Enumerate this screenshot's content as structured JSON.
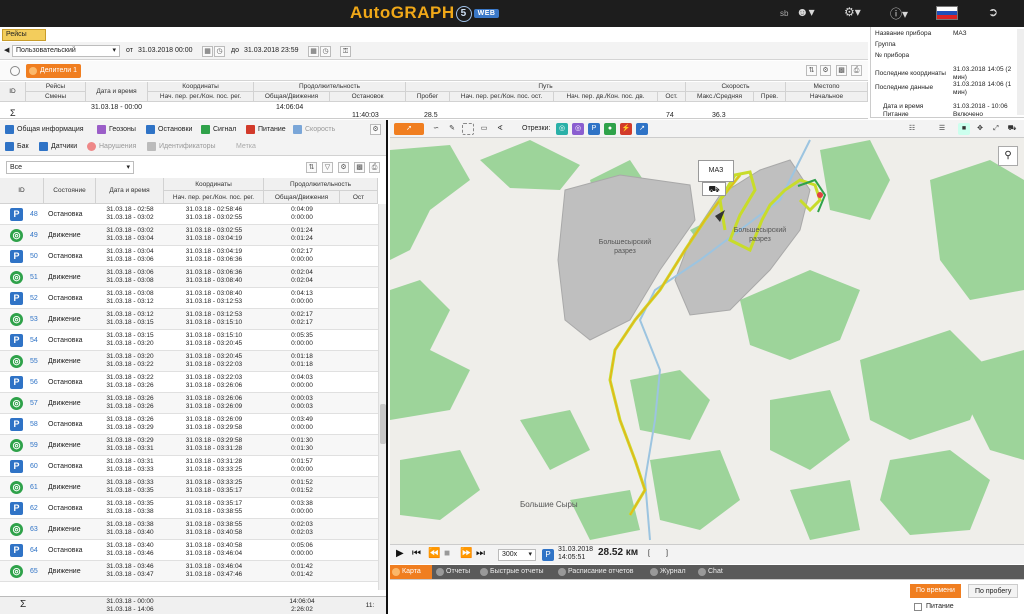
{
  "app": {
    "logo": "AutoGRAPH",
    "logo_num": "5",
    "logo_web": "WEB",
    "user": "sb"
  },
  "colors": {
    "accent": "#f07e20",
    "park": "#2f73c6",
    "move": "#2fa24a",
    "forest": "#9dd49a",
    "quarry": "#bfbfbf",
    "track": "#c8dc2a"
  },
  "panel_tab": "Рейсы",
  "trip_toolbar": {
    "mode": "Пользовательский",
    "from_label": "от",
    "from_value": "31.03.2018 00:00",
    "to_label": "до",
    "to_value": "31.03.2018 23:59"
  },
  "deliteli": "Делители 1",
  "trip_table": {
    "headers": [
      "ID",
      "Рейсы",
      "Дата и время",
      "Координаты",
      "Продолжительность",
      "Путь",
      "Скорость",
      "Местопо"
    ],
    "subheaders": [
      "Смены",
      "Нач. пер. рег./Кон. пос. рег.",
      "Общая/Движения",
      "Остановок",
      "Пробег",
      "Нач. пер. рег./Кон. пос. ост.",
      "Нач. пер. дв./Кон. пос. дв.",
      "Ост.",
      "Макс./Средняя",
      "Прев.",
      "Начальное"
    ],
    "sum_time": "14:06:04",
    "sum_sigma": "Σ",
    "row_date": "31.03.18 - 00:00",
    "row_stop": "11:40:03",
    "row_path": "28.5",
    "row_ost": "74",
    "row_speed": "36.3"
  },
  "info": {
    "rows": [
      {
        "k": "Название прибора",
        "v": "МАЗ"
      },
      {
        "k": "Группа",
        "v": ""
      },
      {
        "k": "№ прибора",
        "v": ""
      },
      {
        "k": "Последние координаты",
        "v": "31.03.2018 14:05 (2 мин)"
      },
      {
        "k": "Последние данные",
        "v": "31.03.2018 14:06 (1 мин)"
      },
      {
        "k": "Дата и время",
        "v": "31.03.2018 - 10:06"
      },
      {
        "k": "Питание",
        "v": "Включено"
      }
    ]
  },
  "left_tabs": [
    {
      "label": "Общая информация",
      "color": "#2f73c6"
    },
    {
      "label": "Геозоны",
      "color": "#9b5ec8"
    },
    {
      "label": "Остановки",
      "color": "#2f73c6"
    },
    {
      "label": "Сигнал",
      "color": "#2fa24a"
    },
    {
      "label": "Питание",
      "color": "#d23a2a"
    },
    {
      "label": "Скорость",
      "color": "#7aa6d8"
    },
    {
      "label": "Бак",
      "color": "#2f73c6"
    },
    {
      "label": "Датчики",
      "color": "#2f73c6"
    },
    {
      "label": "Нарушения",
      "color": "#e04040"
    },
    {
      "label": "Идентификаторы",
      "color": "#aaaaaa"
    },
    {
      "label": "Метка",
      "color": "#cccccc"
    }
  ],
  "filter": {
    "value": "Все"
  },
  "stops_table": {
    "headers": {
      "id": "ID",
      "state": "Состояние",
      "datetime": "Дата и время",
      "coords": "Координаты",
      "coords_sub": "Нач. пер. рег./Кон. пос. рег.",
      "duration": "Продолжительность",
      "duration_sub": "Общая/Движения",
      "last": "Ост"
    },
    "rows": [
      {
        "id": "48",
        "state": "Остановка",
        "type": "p",
        "dt1": "31.03.18 - 02:58",
        "dt2": "31.03.18 - 03:02",
        "c1": "31.03.18 - 02:58:46",
        "c2": "31.03.18 - 03:02:55",
        "d1": "0:04:09",
        "d2": "0:00:00"
      },
      {
        "id": "49",
        "state": "Движение",
        "type": "m",
        "dt1": "31.03.18 - 03:02",
        "dt2": "31.03.18 - 03:04",
        "c1": "31.03.18 - 03:02:55",
        "c2": "31.03.18 - 03:04:19",
        "d1": "0:01:24",
        "d2": "0:01:24"
      },
      {
        "id": "50",
        "state": "Остановка",
        "type": "p",
        "dt1": "31.03.18 - 03:04",
        "dt2": "31.03.18 - 03:06",
        "c1": "31.03.18 - 03:04:19",
        "c2": "31.03.18 - 03:06:36",
        "d1": "0:02:17",
        "d2": "0:00:00"
      },
      {
        "id": "51",
        "state": "Движение",
        "type": "m",
        "dt1": "31.03.18 - 03:06",
        "dt2": "31.03.18 - 03:08",
        "c1": "31.03.18 - 03:06:36",
        "c2": "31.03.18 - 03:08:40",
        "d1": "0:02:04",
        "d2": "0:02:04"
      },
      {
        "id": "52",
        "state": "Остановка",
        "type": "p",
        "dt1": "31.03.18 - 03:08",
        "dt2": "31.03.18 - 03:12",
        "c1": "31.03.18 - 03:08:40",
        "c2": "31.03.18 - 03:12:53",
        "d1": "0:04:13",
        "d2": "0:00:00"
      },
      {
        "id": "53",
        "state": "Движение",
        "type": "m",
        "dt1": "31.03.18 - 03:12",
        "dt2": "31.03.18 - 03:15",
        "c1": "31.03.18 - 03:12:53",
        "c2": "31.03.18 - 03:15:10",
        "d1": "0:02:17",
        "d2": "0:02:17"
      },
      {
        "id": "54",
        "state": "Остановка",
        "type": "p",
        "dt1": "31.03.18 - 03:15",
        "dt2": "31.03.18 - 03:20",
        "c1": "31.03.18 - 03:15:10",
        "c2": "31.03.18 - 03:20:45",
        "d1": "0:05:35",
        "d2": "0:00:00"
      },
      {
        "id": "55",
        "state": "Движение",
        "type": "m",
        "dt1": "31.03.18 - 03:20",
        "dt2": "31.03.18 - 03:22",
        "c1": "31.03.18 - 03:20:45",
        "c2": "31.03.18 - 03:22:03",
        "d1": "0:01:18",
        "d2": "0:01:18"
      },
      {
        "id": "56",
        "state": "Остановка",
        "type": "p",
        "dt1": "31.03.18 - 03:22",
        "dt2": "31.03.18 - 03:26",
        "c1": "31.03.18 - 03:22:03",
        "c2": "31.03.18 - 03:26:06",
        "d1": "0:04:03",
        "d2": "0:00:00"
      },
      {
        "id": "57",
        "state": "Движение",
        "type": "m",
        "dt1": "31.03.18 - 03:26",
        "dt2": "31.03.18 - 03:26",
        "c1": "31.03.18 - 03:26:06",
        "c2": "31.03.18 - 03:26:09",
        "d1": "0:00:03",
        "d2": "0:00:03"
      },
      {
        "id": "58",
        "state": "Остановка",
        "type": "p",
        "dt1": "31.03.18 - 03:26",
        "dt2": "31.03.18 - 03:29",
        "c1": "31.03.18 - 03:26:09",
        "c2": "31.03.18 - 03:29:58",
        "d1": "0:03:49",
        "d2": "0:00:00"
      },
      {
        "id": "59",
        "state": "Движение",
        "type": "m",
        "dt1": "31.03.18 - 03:29",
        "dt2": "31.03.18 - 03:31",
        "c1": "31.03.18 - 03:29:58",
        "c2": "31.03.18 - 03:31:28",
        "d1": "0:01:30",
        "d2": "0:01:30"
      },
      {
        "id": "60",
        "state": "Остановка",
        "type": "p",
        "dt1": "31.03.18 - 03:31",
        "dt2": "31.03.18 - 03:33",
        "c1": "31.03.18 - 03:31:28",
        "c2": "31.03.18 - 03:33:25",
        "d1": "0:01:57",
        "d2": "0:00:00"
      },
      {
        "id": "61",
        "state": "Движение",
        "type": "m",
        "dt1": "31.03.18 - 03:33",
        "dt2": "31.03.18 - 03:35",
        "c1": "31.03.18 - 03:33:25",
        "c2": "31.03.18 - 03:35:17",
        "d1": "0:01:52",
        "d2": "0:01:52"
      },
      {
        "id": "62",
        "state": "Остановка",
        "type": "p",
        "dt1": "31.03.18 - 03:35",
        "dt2": "31.03.18 - 03:38",
        "c1": "31.03.18 - 03:35:17",
        "c2": "31.03.18 - 03:38:55",
        "d1": "0:03:38",
        "d2": "0:00:00"
      },
      {
        "id": "63",
        "state": "Движение",
        "type": "m",
        "dt1": "31.03.18 - 03:38",
        "dt2": "31.03.18 - 03:40",
        "c1": "31.03.18 - 03:38:55",
        "c2": "31.03.18 - 03:40:58",
        "d1": "0:02:03",
        "d2": "0:02:03"
      },
      {
        "id": "64",
        "state": "Остановка",
        "type": "p",
        "dt1": "31.03.18 - 03:40",
        "dt2": "31.03.18 - 03:46",
        "c1": "31.03.18 - 03:40:58",
        "c2": "31.03.18 - 03:46:04",
        "d1": "0:05:06",
        "d2": "0:00:00"
      },
      {
        "id": "65",
        "state": "Движение",
        "type": "m",
        "dt1": "31.03.18 - 03:46",
        "dt2": "31.03.18 - 03:47",
        "c1": "31.03.18 - 03:46:04",
        "c2": "31.03.18 - 03:47:46",
        "d1": "0:01:42",
        "d2": "0:01:42"
      }
    ],
    "sum": {
      "sigma": "Σ",
      "dt1": "31.03.18 - 00:00",
      "dt2": "31.03.18 - 14:06",
      "d1": "14:06:04",
      "d2": "2:26:02",
      "last": "11:"
    }
  },
  "map": {
    "segment_label": "Отрезки:",
    "vehicle": "МАЗ",
    "labels": {
      "quarry1": "Большесырский разрез",
      "quarry2": "Большесырский разрез",
      "village": "Большие Сыры"
    }
  },
  "player": {
    "speed": "300x",
    "date": "31.03.2018",
    "time": "14:05:51",
    "distance": "28.52 км"
  },
  "bottom_tabs": [
    "Карта",
    "Отчеты",
    "Быстрые отчеты",
    "Расписание отчетов",
    "Журнал",
    "Chat"
  ],
  "bottom_right": {
    "by_time": "По времени",
    "by_mileage": "По пробегу",
    "power": "Питание"
  }
}
